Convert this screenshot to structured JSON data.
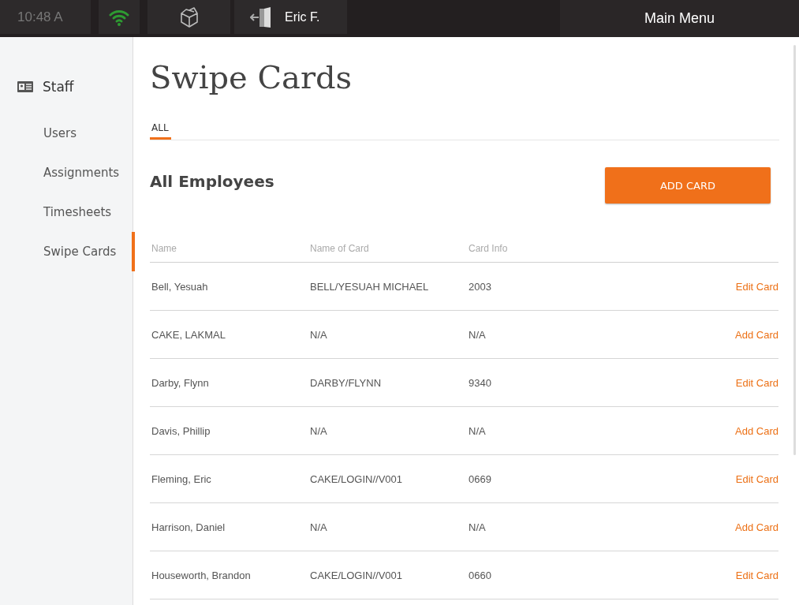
{
  "top_bar": {
    "time": "10:48 A",
    "user": "Eric F.",
    "menu": "Main Menu"
  },
  "sidebar": {
    "section": "Staff",
    "items": [
      {
        "label": "Users",
        "selected": false
      },
      {
        "label": "Assignments",
        "selected": false
      },
      {
        "label": "Timesheets",
        "selected": false
      },
      {
        "label": "Swipe Cards",
        "selected": true
      }
    ]
  },
  "title": "Swipe Cards",
  "tabs": [
    {
      "label": "ALL",
      "selected": true
    }
  ],
  "heading": "All Employees",
  "add_button": "ADD CARD",
  "table": {
    "columns": [
      "Name",
      "Name of Card",
      "Card Info"
    ],
    "rows": [
      {
        "name": "Bell, Yesuah",
        "card_name": "BELL/YESUAH MICHAEL",
        "card_info": "2003",
        "action": "Edit Card"
      },
      {
        "name": "CAKE, LAKMAL",
        "card_name": "N/A",
        "card_info": "N/A",
        "action": "Add Card"
      },
      {
        "name": "Darby, Flynn",
        "card_name": "DARBY/FLYNN",
        "card_info": "9340",
        "action": "Edit Card"
      },
      {
        "name": "Davis, Phillip",
        "card_name": "N/A",
        "card_info": "N/A",
        "action": "Add Card"
      },
      {
        "name": "Fleming, Eric",
        "card_name": "CAKE/LOGIN//V001",
        "card_info": "0669",
        "action": "Edit Card"
      },
      {
        "name": "Harrison, Daniel",
        "card_name": "N/A",
        "card_info": "N/A",
        "action": "Add Card"
      },
      {
        "name": "Houseworth, Brandon",
        "card_name": "CAKE/LOGIN//V001",
        "card_info": "0660",
        "action": "Edit Card"
      }
    ]
  }
}
